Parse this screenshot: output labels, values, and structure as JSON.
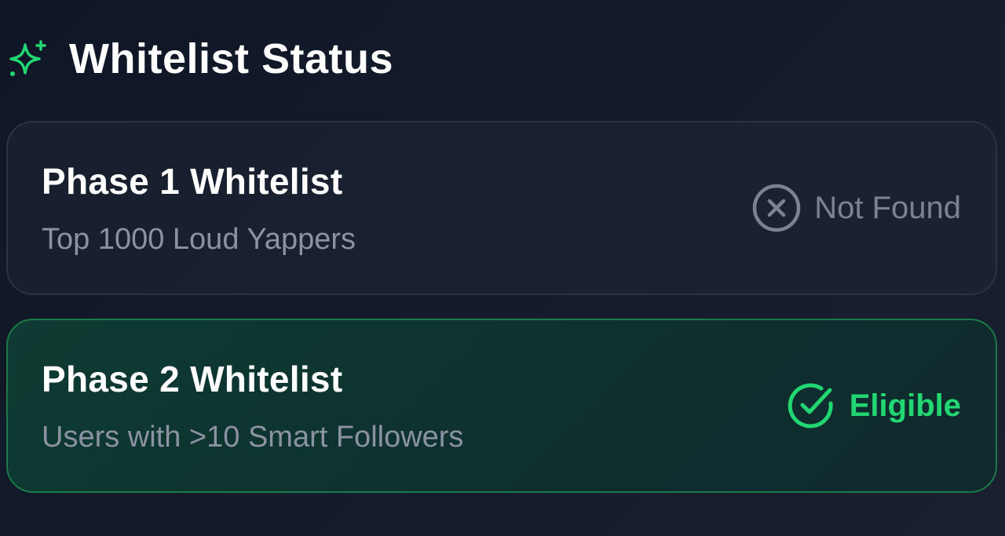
{
  "header": {
    "title": "Whitelist Status",
    "icon": "sparkle-icon"
  },
  "colors": {
    "accent": "#22d672",
    "muted": "#7b8392",
    "background": "#141b2b"
  },
  "phases": [
    {
      "title": "Phase 1 Whitelist",
      "subtitle": "Top 1000 Loud Yappers",
      "status": "Not Found",
      "status_icon": "x-circle-icon"
    },
    {
      "title": "Phase 2 Whitelist",
      "subtitle": "Users with >10 Smart Followers",
      "status": "Eligible",
      "status_icon": "check-circle-icon"
    }
  ]
}
